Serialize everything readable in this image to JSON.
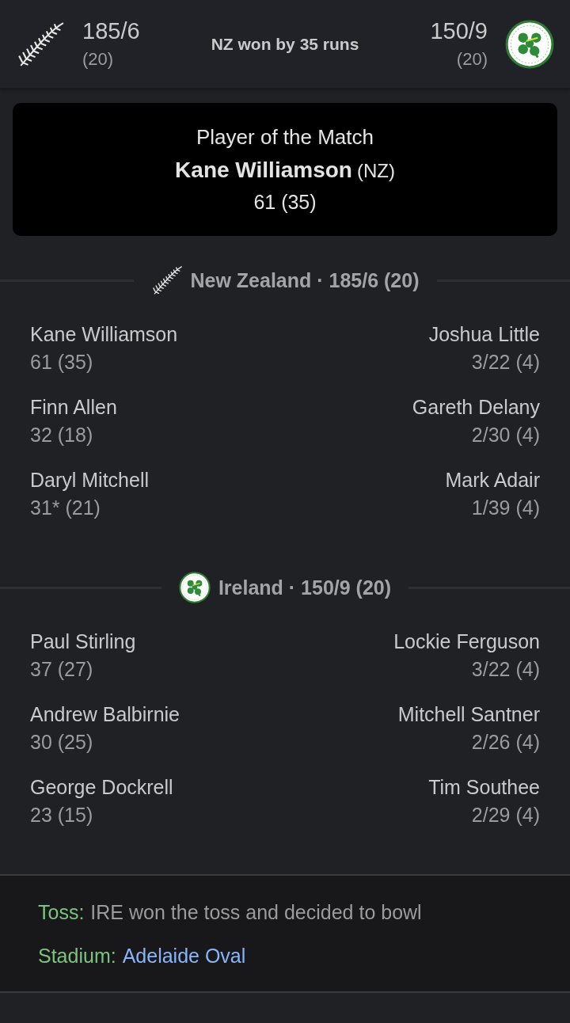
{
  "header": {
    "home": {
      "logo": {
        "kind": "fern"
      },
      "score": "185/6",
      "overs": "(20)"
    },
    "result": "NZ won by 35 runs",
    "away": {
      "logo": {
        "kind": "shamrock"
      },
      "score": "150/9",
      "overs": "(20)"
    }
  },
  "player_of_match": {
    "title": "Player of the Match",
    "name": "Kane Williamson",
    "team": "(NZ)",
    "figures": "61 (35)"
  },
  "innings": [
    {
      "logo": {
        "kind": "fern"
      },
      "title": "New Zealand · 185/6 (20)",
      "rows": [
        {
          "batter": "Kane Williamson",
          "batting": "61 (35)",
          "bowler": "Joshua Little",
          "bowling": "3/22 (4)"
        },
        {
          "batter": "Finn Allen",
          "batting": "32 (18)",
          "bowler": "Gareth Delany",
          "bowling": "2/30 (4)"
        },
        {
          "batter": "Daryl Mitchell",
          "batting": "31* (21)",
          "bowler": "Mark Adair",
          "bowling": "1/39 (4)"
        }
      ]
    },
    {
      "logo": {
        "kind": "shamrock"
      },
      "title": "Ireland · 150/9 (20)",
      "rows": [
        {
          "batter": "Paul Stirling",
          "batting": "37 (27)",
          "bowler": "Lockie Ferguson",
          "bowling": "3/22 (4)"
        },
        {
          "batter": "Andrew Balbirnie",
          "batting": "30 (25)",
          "bowler": "Mitchell Santner",
          "bowling": "2/26 (4)"
        },
        {
          "batter": "George Dockrell",
          "batting": "23 (15)",
          "bowler": "Tim Southee",
          "bowling": "2/29 (4)"
        }
      ]
    }
  ],
  "info": [
    {
      "label": "Toss:",
      "value": "IRE won the toss and decided to bowl",
      "kind": "text"
    },
    {
      "label": "Stadium:",
      "value": "Adelaide Oval",
      "kind": "link"
    }
  ]
}
